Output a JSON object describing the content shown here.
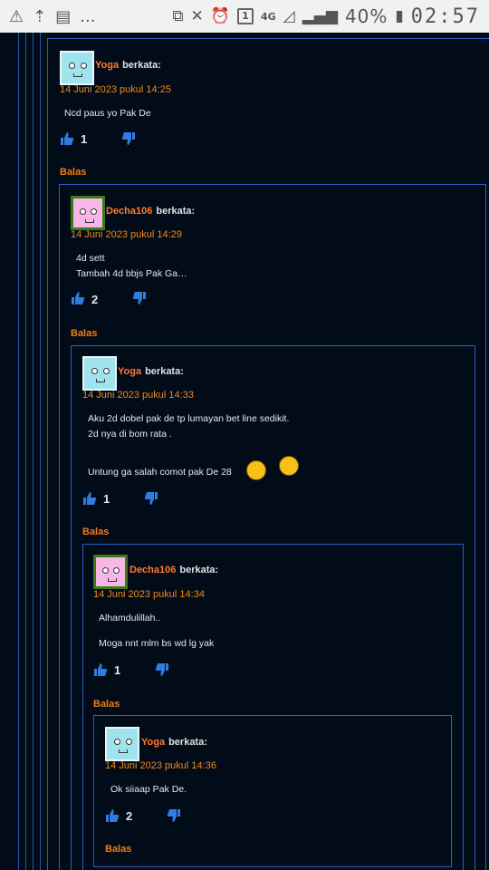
{
  "status_bar": {
    "left_icons": [
      "warning-icon",
      "usb-debug-icon",
      "news-icon"
    ],
    "overflow": "...",
    "network": "4G",
    "sim": "1",
    "battery_percent": "40%",
    "time": "02:57"
  },
  "comments": [
    {
      "author": "Yoga",
      "says": "berkata:",
      "date": "14 Juni 2023 pukul 14:25",
      "lines": [
        "Ncd paus yo Pak De"
      ],
      "likes": "1",
      "reply_label": "Balas",
      "avatar": "yoga"
    },
    {
      "author": "Decha106",
      "says": "berkata:",
      "date": "14 Juni 2023 pukul 14:29",
      "lines": [
        "4d sett",
        "Tambah 4d bbjs Pak Ga…"
      ],
      "likes": "2",
      "reply_label": "Balas",
      "avatar": "decha"
    },
    {
      "author": "Yoga",
      "says": "berkata:",
      "date": "14 Juni 2023 pukul 14:33",
      "lines": [
        "Aku 2d dobel pak de tp lumayan bet line sedikit.",
        "2d nya di bom rata .",
        "Untung ga salah comot pak De 28"
      ],
      "likes": "1",
      "reply_label": "Balas",
      "avatar": "yoga"
    },
    {
      "author": "Decha106",
      "says": "berkata:",
      "date": "14 Juni 2023 pukul 14:34",
      "lines": [
        "Alhamdulillah..",
        "Moga nnt mlm bs wd lg yak"
      ],
      "likes": "1",
      "reply_label": "Balas",
      "avatar": "decha"
    },
    {
      "author": "Yoga",
      "says": "berkata:",
      "date": "14 Juni 2023 pukul 14:36",
      "lines": [
        "Ok siiaap Pak De."
      ],
      "likes": "2",
      "reply_label": "Balas",
      "avatar": "yoga"
    }
  ]
}
